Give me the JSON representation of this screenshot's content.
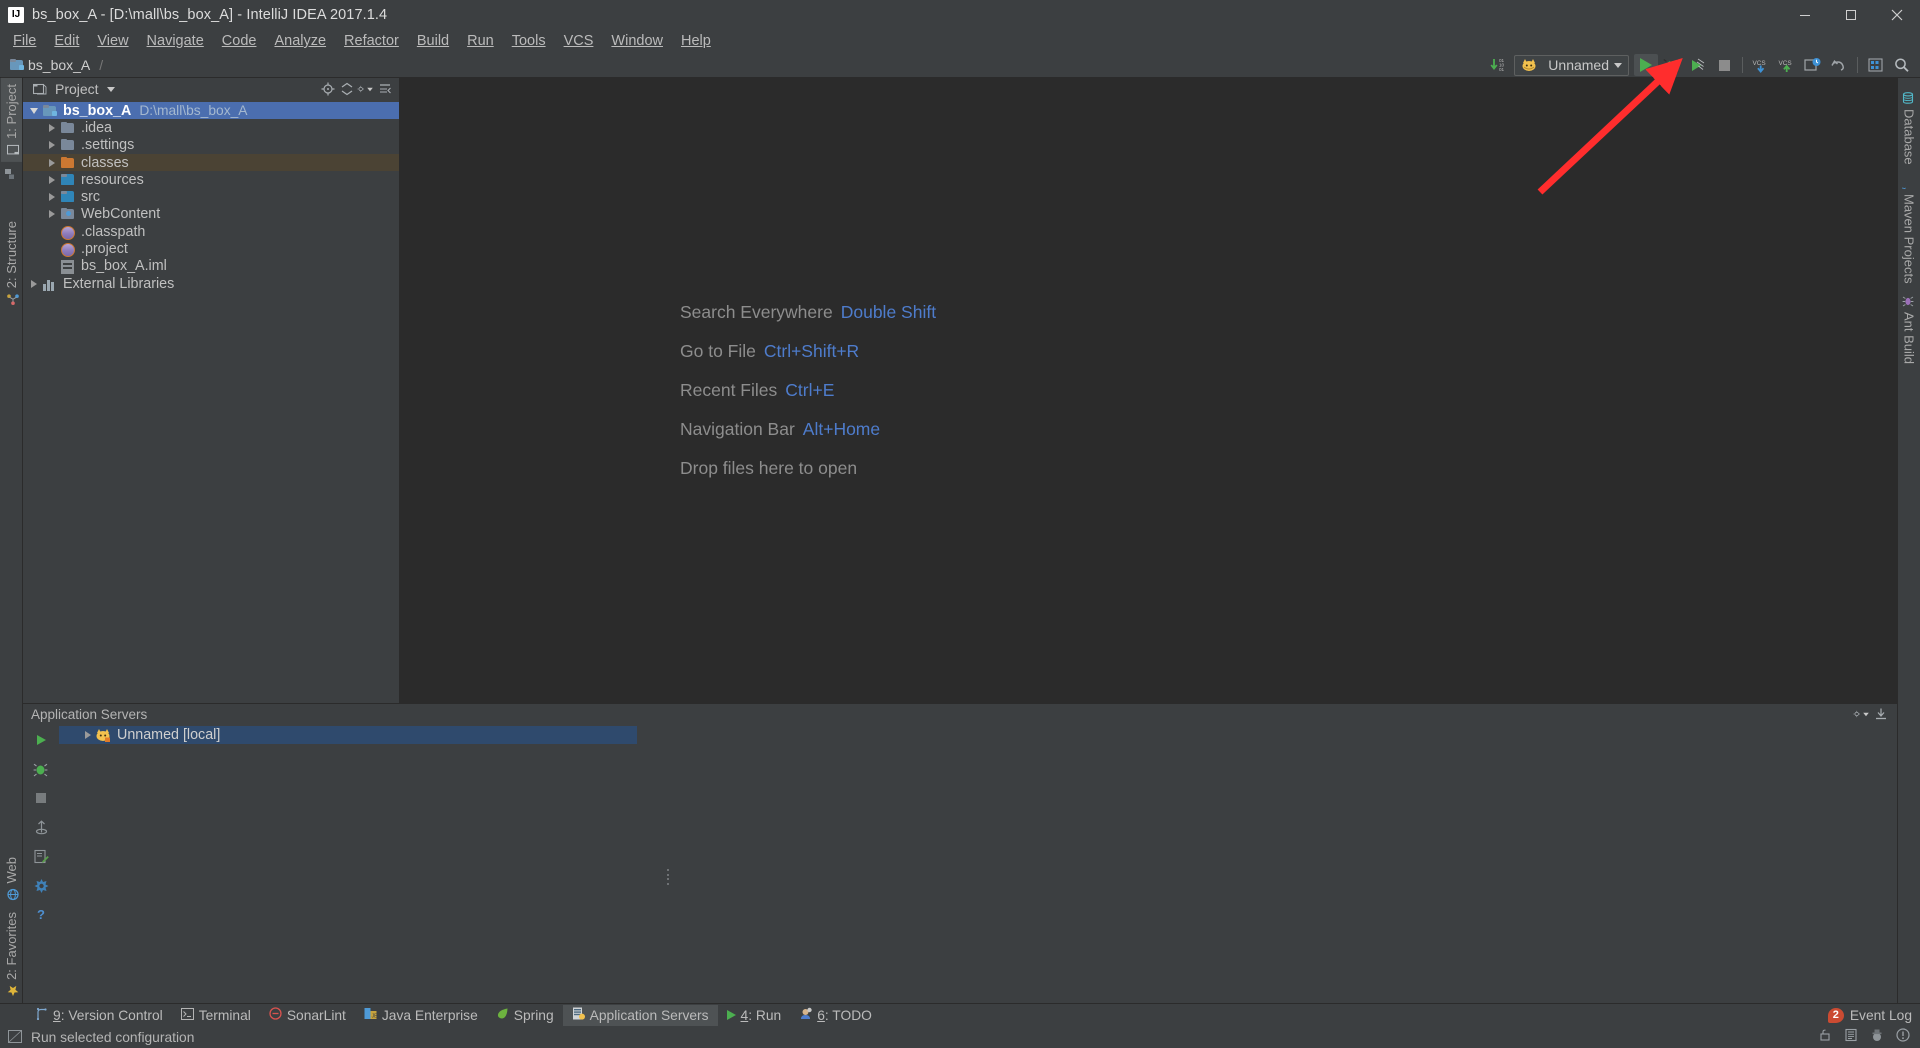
{
  "window": {
    "title": "bs_box_A - [D:\\mall\\bs_box_A] - IntelliJ IDEA 2017.1.4",
    "logo": "IJ",
    "minimize_label": "minimize-icon",
    "maximize_label": "maximize-icon",
    "close_label": "close-icon"
  },
  "menubar": {
    "items": [
      {
        "label": "File"
      },
      {
        "label": "Edit"
      },
      {
        "label": "View"
      },
      {
        "label": "Navigate"
      },
      {
        "label": "Code"
      },
      {
        "label": "Analyze"
      },
      {
        "label": "Refactor"
      },
      {
        "label": "Build"
      },
      {
        "label": "Run"
      },
      {
        "label": "Tools"
      },
      {
        "label": "VCS"
      },
      {
        "label": "Window"
      },
      {
        "label": "Help"
      }
    ]
  },
  "navbar": {
    "breadcrumb": "bs_box_A"
  },
  "toolbar": {
    "update_project_icon": "update-project-icon",
    "run_config_name": "Unnamed",
    "run_config_icon": "tomcat-icon",
    "run_label": "run-icon",
    "debug_label": "debug-icon",
    "coverage_label": "run-with-coverage-icon",
    "stop_label": "stop-icon",
    "vcs_update_label": "vcs-update-icon",
    "vcs_commit_label": "vcs-commit-icon",
    "history_label": "local-history-icon",
    "undo_label": "undo-icon",
    "settings_label": "settings-icon",
    "search_label": "search-icon"
  },
  "left_stripe": {
    "top": [
      {
        "label": "1: Project",
        "icon": "project-icon",
        "active": true
      },
      {
        "label": "",
        "icon": "structure-small-icon",
        "active": false
      }
    ],
    "middle": [
      {
        "label": "2: Structure",
        "icon": "structure-icon",
        "active": false
      }
    ],
    "bottom": [
      {
        "label": "Web",
        "icon": "web-icon",
        "active": false
      },
      {
        "label": "2: Favorites",
        "icon": "favorites-icon",
        "active": false
      }
    ]
  },
  "right_stripe": {
    "items": [
      {
        "label": "Database",
        "icon": "database-icon"
      },
      {
        "label": "Maven Projects",
        "icon": "maven-icon"
      },
      {
        "label": "Ant Build",
        "icon": "ant-icon"
      }
    ]
  },
  "project_panel": {
    "title": "Project",
    "view_caret": "chevron-down-icon",
    "header_icons": [
      "locate-icon",
      "collapse-all-icon",
      "settings-icon",
      "hide-icon"
    ],
    "tree": [
      {
        "label": "bs_box_A",
        "path": "D:\\mall\\bs_box_A",
        "icon": "module-folder",
        "indent": 0,
        "twist": "down",
        "state": "selected"
      },
      {
        "label": ".idea",
        "path": "",
        "icon": "folder",
        "indent": 1,
        "twist": "right",
        "state": ""
      },
      {
        "label": ".settings",
        "path": "",
        "icon": "folder",
        "indent": 1,
        "twist": "right",
        "state": ""
      },
      {
        "label": "classes",
        "path": "",
        "icon": "folder-orange",
        "indent": 1,
        "twist": "right",
        "state": "highlight"
      },
      {
        "label": "resources",
        "path": "",
        "icon": "folder-source",
        "indent": 1,
        "twist": "right",
        "state": ""
      },
      {
        "label": "src",
        "path": "",
        "icon": "folder-source",
        "indent": 1,
        "twist": "right",
        "state": ""
      },
      {
        "label": "WebContent",
        "path": "",
        "icon": "folder-web",
        "indent": 1,
        "twist": "right",
        "state": ""
      },
      {
        "label": ".classpath",
        "path": "",
        "icon": "xml-file",
        "indent": 1,
        "twist": "none",
        "state": ""
      },
      {
        "label": ".project",
        "path": "",
        "icon": "xml-file",
        "indent": 1,
        "twist": "none",
        "state": ""
      },
      {
        "label": "bs_box_A.iml",
        "path": "",
        "icon": "iml-file",
        "indent": 1,
        "twist": "none",
        "state": ""
      },
      {
        "label": "External Libraries",
        "path": "",
        "icon": "libraries",
        "indent": 0,
        "twist": "right",
        "state": ""
      }
    ]
  },
  "editor": {
    "welcome_rows": [
      {
        "action": "Search Everywhere",
        "shortcut": "Double Shift"
      },
      {
        "action": "Go to File",
        "shortcut": "Ctrl+Shift+R"
      },
      {
        "action": "Recent Files",
        "shortcut": "Ctrl+E"
      },
      {
        "action": "Navigation Bar",
        "shortcut": "Alt+Home"
      },
      {
        "action": "Drop files here to open",
        "shortcut": ""
      }
    ]
  },
  "bottom_window": {
    "title": "Application Servers",
    "settings_icon": "settings-icon",
    "hide_icon": "hide-icon",
    "side_buttons": [
      {
        "name": "run-button",
        "icon": "run-icon"
      },
      {
        "name": "debug-button",
        "icon": "debug-icon"
      },
      {
        "name": "stop-button",
        "icon": "stop-icon"
      },
      {
        "name": "deploy-button",
        "icon": "deploy-icon"
      },
      {
        "name": "edit-configuration-button",
        "icon": "edit-configuration-icon"
      },
      {
        "name": "settings-button",
        "icon": "settings-icon"
      },
      {
        "name": "help-button",
        "icon": "help-icon"
      }
    ],
    "rows": [
      {
        "label": "Unnamed [local]",
        "icon": "tomcat-icon",
        "twist": "right",
        "selected": true
      }
    ]
  },
  "toolwindow_bar": {
    "left_items": [
      {
        "key": "9",
        "label": ": Version Control",
        "icon": "vcs-icon",
        "active": false
      },
      {
        "key": "",
        "label": "Terminal",
        "icon": "terminal-icon",
        "active": false
      },
      {
        "key": "",
        "label": "SonarLint",
        "icon": "sonarlint-icon",
        "active": false
      },
      {
        "key": "",
        "label": "Java Enterprise",
        "icon": "java-enterprise-icon",
        "active": false
      },
      {
        "key": "",
        "label": "Spring",
        "icon": "spring-icon",
        "active": false
      },
      {
        "key": "",
        "label": "Application Servers",
        "icon": "application-servers-icon",
        "active": true
      },
      {
        "key": "4",
        "label": ": Run",
        "icon": "run-icon",
        "active": false
      },
      {
        "key": "6",
        "label": ": TODO",
        "icon": "todo-icon",
        "active": false
      }
    ],
    "event_log": {
      "label": "Event Log",
      "count": "2"
    }
  },
  "statusbar": {
    "message": "Run selected configuration",
    "right_icons": [
      "lock-icon",
      "memory-icon",
      "hector-icon",
      "error-icon"
    ]
  },
  "colors": {
    "accent_blue": "#4b6eaf",
    "link_blue": "#4e7ccc",
    "green_run": "#4caf50",
    "orange_folder": "#cc7832",
    "panel_bg": "#3c3f41",
    "editor_bg": "#2b2b2b",
    "arrow_red": "#ff2d2d"
  }
}
